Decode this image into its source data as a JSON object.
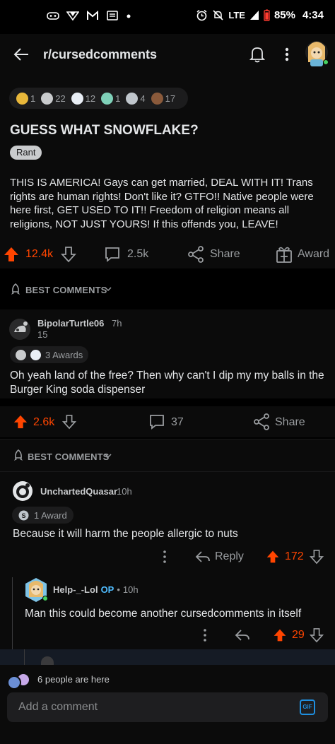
{
  "status_bar": {
    "lte": "LTE",
    "battery": "85%",
    "time": "4:34",
    "left_icons": [
      "controller-icon",
      "direct-icon",
      "gmail-icon",
      "message-icon",
      "dot-icon"
    ],
    "right_icons": [
      "alarm-icon",
      "mute-icon",
      "signal-icon",
      "battery-icon"
    ]
  },
  "header": {
    "subreddit": "r/cursedcomments"
  },
  "post": {
    "awards": [
      {
        "icon": "grin-award-icon",
        "count": "1",
        "color": "#e8b73a"
      },
      {
        "icon": "wholesome-award-icon",
        "count": "22",
        "color": "#c9cbcd"
      },
      {
        "icon": "helpful-award-icon",
        "count": "12",
        "color": "#e9eef5"
      },
      {
        "icon": "hugz-award-icon",
        "count": "1",
        "color": "#7fd1b9"
      },
      {
        "icon": "silver-award-icon",
        "count": "4",
        "color": "#c0c6cc"
      },
      {
        "icon": "poop-award-icon",
        "count": "17",
        "color": "#8a5a3b"
      }
    ],
    "title": "GUESS WHAT SNOWFLAKE?",
    "flair": "Rant",
    "body": "THIS IS AMERICA! Gays can get married, DEAL WITH IT! Trans rights are human rights! Don't like it? GTFO!! Native people were here first, GET USED TO IT!! Freedom of religion means all religions, NOT JUST YOURS! If this offends you, LEAVE!",
    "score": "12.4k",
    "comments": "2.5k",
    "share": "Share",
    "award": "Award"
  },
  "sort1": {
    "label": "BEST COMMENTS"
  },
  "comment1": {
    "user": "BipolarTurtle06",
    "age": "7h",
    "flair_count": "15",
    "awards_text": "3 Awards",
    "text": "Oh yeah land of the free? Then why can't I dip my my balls in the Burger King soda dispenser",
    "score": "2.6k",
    "comments": "37",
    "share": "Share"
  },
  "sort2": {
    "label": "BEST COMMENTS"
  },
  "comment2": {
    "user": "UnchartedQuasar",
    "age": "10h",
    "award_text": "1 Award",
    "text": "Because it will harm the people allergic to nuts",
    "reply": "Reply",
    "score": "172"
  },
  "comment3": {
    "user": "Help-_-Lol",
    "op": "OP",
    "age": "10h",
    "text": "Man this could become another cursedcomments in itself",
    "score": "29"
  },
  "footer": {
    "presence": "6 people are here",
    "placeholder": "Add a comment",
    "gif": "GIF"
  },
  "colors": {
    "upvote": "#ff4500",
    "background": "#0b0b0b",
    "text": "#d7dadc",
    "muted": "#9a9da0",
    "link": "#4fbcff"
  }
}
